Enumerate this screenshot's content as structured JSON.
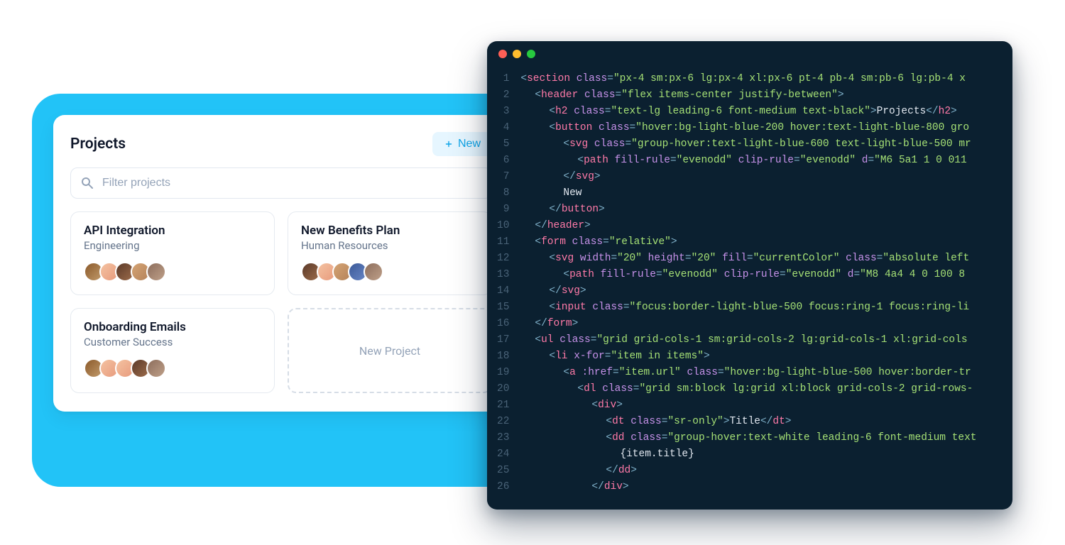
{
  "left": {
    "title": "Projects",
    "new_label": "New",
    "search_placeholder": "Filter projects",
    "projects": [
      {
        "title": "API Integration",
        "subtitle": "Engineering",
        "avatar_count": 5
      },
      {
        "title": "New Benefits Plan",
        "subtitle": "Human Resources",
        "avatar_count": 5
      },
      {
        "title": "Onboarding Emails",
        "subtitle": "Customer Success",
        "avatar_count": 5
      }
    ],
    "new_project_label": "New Project"
  },
  "editor": {
    "traffic_lights": [
      "close",
      "minimize",
      "maximize"
    ],
    "lines": [
      {
        "n": 1,
        "indent": 1,
        "tokens": [
          {
            "c": "t-punc",
            "t": "<"
          },
          {
            "c": "t-tag",
            "t": "section"
          },
          {
            "c": "",
            "t": " "
          },
          {
            "c": "t-attr",
            "t": "class"
          },
          {
            "c": "t-punc",
            "t": "="
          },
          {
            "c": "t-str",
            "t": "\"px-4 sm:px-6 lg:px-4 xl:px-6 pt-4 pb-4 sm:pb-6 lg:pb-4 x"
          }
        ]
      },
      {
        "n": 2,
        "indent": 2,
        "tokens": [
          {
            "c": "t-punc",
            "t": "<"
          },
          {
            "c": "t-tag",
            "t": "header"
          },
          {
            "c": "",
            "t": " "
          },
          {
            "c": "t-attr",
            "t": "class"
          },
          {
            "c": "t-punc",
            "t": "="
          },
          {
            "c": "t-str",
            "t": "\"flex items-center justify-between\""
          },
          {
            "c": "t-punc",
            "t": ">"
          }
        ]
      },
      {
        "n": 3,
        "indent": 3,
        "tokens": [
          {
            "c": "t-punc",
            "t": "<"
          },
          {
            "c": "t-tag",
            "t": "h2"
          },
          {
            "c": "",
            "t": " "
          },
          {
            "c": "t-attr",
            "t": "class"
          },
          {
            "c": "t-punc",
            "t": "="
          },
          {
            "c": "t-str",
            "t": "\"text-lg leading-6 font-medium text-black\""
          },
          {
            "c": "t-punc",
            "t": ">"
          },
          {
            "c": "t-text",
            "t": "Projects"
          },
          {
            "c": "t-punc",
            "t": "</"
          },
          {
            "c": "t-tag",
            "t": "h2"
          },
          {
            "c": "t-punc",
            "t": ">"
          }
        ]
      },
      {
        "n": 4,
        "indent": 3,
        "tokens": [
          {
            "c": "t-punc",
            "t": "<"
          },
          {
            "c": "t-tag",
            "t": "button"
          },
          {
            "c": "",
            "t": " "
          },
          {
            "c": "t-attr",
            "t": "class"
          },
          {
            "c": "t-punc",
            "t": "="
          },
          {
            "c": "t-str",
            "t": "\"hover:bg-light-blue-200 hover:text-light-blue-800 gro"
          }
        ]
      },
      {
        "n": 5,
        "indent": 4,
        "tokens": [
          {
            "c": "t-punc",
            "t": "<"
          },
          {
            "c": "t-tag",
            "t": "svg"
          },
          {
            "c": "",
            "t": " "
          },
          {
            "c": "t-attr",
            "t": "class"
          },
          {
            "c": "t-punc",
            "t": "="
          },
          {
            "c": "t-str",
            "t": "\"group-hover:text-light-blue-600 text-light-blue-500 mr"
          }
        ]
      },
      {
        "n": 6,
        "indent": 5,
        "tokens": [
          {
            "c": "t-punc",
            "t": "<"
          },
          {
            "c": "t-tag",
            "t": "path"
          },
          {
            "c": "",
            "t": " "
          },
          {
            "c": "t-attr",
            "t": "fill-rule"
          },
          {
            "c": "t-punc",
            "t": "="
          },
          {
            "c": "t-str",
            "t": "\"evenodd\""
          },
          {
            "c": "",
            "t": " "
          },
          {
            "c": "t-attr",
            "t": "clip-rule"
          },
          {
            "c": "t-punc",
            "t": "="
          },
          {
            "c": "t-str",
            "t": "\"evenodd\""
          },
          {
            "c": "",
            "t": " "
          },
          {
            "c": "t-attr",
            "t": "d"
          },
          {
            "c": "t-punc",
            "t": "="
          },
          {
            "c": "t-str",
            "t": "\"M6 5a1 1 0 011"
          }
        ]
      },
      {
        "n": 7,
        "indent": 4,
        "tokens": [
          {
            "c": "t-punc",
            "t": "</"
          },
          {
            "c": "t-tag",
            "t": "svg"
          },
          {
            "c": "t-punc",
            "t": ">"
          }
        ]
      },
      {
        "n": 8,
        "indent": 4,
        "tokens": [
          {
            "c": "t-text",
            "t": "New"
          }
        ]
      },
      {
        "n": 9,
        "indent": 3,
        "tokens": [
          {
            "c": "t-punc",
            "t": "</"
          },
          {
            "c": "t-tag",
            "t": "button"
          },
          {
            "c": "t-punc",
            "t": ">"
          }
        ]
      },
      {
        "n": 10,
        "indent": 2,
        "tokens": [
          {
            "c": "t-punc",
            "t": "</"
          },
          {
            "c": "t-tag",
            "t": "header"
          },
          {
            "c": "t-punc",
            "t": ">"
          }
        ]
      },
      {
        "n": 11,
        "indent": 2,
        "tokens": [
          {
            "c": "t-punc",
            "t": "<"
          },
          {
            "c": "t-tag",
            "t": "form"
          },
          {
            "c": "",
            "t": " "
          },
          {
            "c": "t-attr",
            "t": "class"
          },
          {
            "c": "t-punc",
            "t": "="
          },
          {
            "c": "t-str",
            "t": "\"relative\""
          },
          {
            "c": "t-punc",
            "t": ">"
          }
        ]
      },
      {
        "n": 12,
        "indent": 3,
        "tokens": [
          {
            "c": "t-punc",
            "t": "<"
          },
          {
            "c": "t-tag",
            "t": "svg"
          },
          {
            "c": "",
            "t": " "
          },
          {
            "c": "t-attr",
            "t": "width"
          },
          {
            "c": "t-punc",
            "t": "="
          },
          {
            "c": "t-str",
            "t": "\"20\""
          },
          {
            "c": "",
            "t": " "
          },
          {
            "c": "t-attr",
            "t": "height"
          },
          {
            "c": "t-punc",
            "t": "="
          },
          {
            "c": "t-str",
            "t": "\"20\""
          },
          {
            "c": "",
            "t": " "
          },
          {
            "c": "t-attr",
            "t": "fill"
          },
          {
            "c": "t-punc",
            "t": "="
          },
          {
            "c": "t-str",
            "t": "\"currentColor\""
          },
          {
            "c": "",
            "t": " "
          },
          {
            "c": "t-attr",
            "t": "class"
          },
          {
            "c": "t-punc",
            "t": "="
          },
          {
            "c": "t-str",
            "t": "\"absolute left"
          }
        ]
      },
      {
        "n": 13,
        "indent": 4,
        "tokens": [
          {
            "c": "t-punc",
            "t": "<"
          },
          {
            "c": "t-tag",
            "t": "path"
          },
          {
            "c": "",
            "t": " "
          },
          {
            "c": "t-attr",
            "t": "fill-rule"
          },
          {
            "c": "t-punc",
            "t": "="
          },
          {
            "c": "t-str",
            "t": "\"evenodd\""
          },
          {
            "c": "",
            "t": " "
          },
          {
            "c": "t-attr",
            "t": "clip-rule"
          },
          {
            "c": "t-punc",
            "t": "="
          },
          {
            "c": "t-str",
            "t": "\"evenodd\""
          },
          {
            "c": "",
            "t": " "
          },
          {
            "c": "t-attr",
            "t": "d"
          },
          {
            "c": "t-punc",
            "t": "="
          },
          {
            "c": "t-str",
            "t": "\"M8 4a4 4 0 100 8"
          }
        ]
      },
      {
        "n": 14,
        "indent": 3,
        "tokens": [
          {
            "c": "t-punc",
            "t": "</"
          },
          {
            "c": "t-tag",
            "t": "svg"
          },
          {
            "c": "t-punc",
            "t": ">"
          }
        ]
      },
      {
        "n": 15,
        "indent": 3,
        "tokens": [
          {
            "c": "t-punc",
            "t": "<"
          },
          {
            "c": "t-tag",
            "t": "input"
          },
          {
            "c": "",
            "t": " "
          },
          {
            "c": "t-attr",
            "t": "class"
          },
          {
            "c": "t-punc",
            "t": "="
          },
          {
            "c": "t-str",
            "t": "\"focus:border-light-blue-500 focus:ring-1 focus:ring-li"
          }
        ]
      },
      {
        "n": 16,
        "indent": 2,
        "tokens": [
          {
            "c": "t-punc",
            "t": "</"
          },
          {
            "c": "t-tag",
            "t": "form"
          },
          {
            "c": "t-punc",
            "t": ">"
          }
        ]
      },
      {
        "n": 17,
        "indent": 2,
        "tokens": [
          {
            "c": "t-punc",
            "t": "<"
          },
          {
            "c": "t-tag",
            "t": "ul"
          },
          {
            "c": "",
            "t": " "
          },
          {
            "c": "t-attr",
            "t": "class"
          },
          {
            "c": "t-punc",
            "t": "="
          },
          {
            "c": "t-str",
            "t": "\"grid grid-cols-1 sm:grid-cols-2 lg:grid-cols-1 xl:grid-cols"
          }
        ]
      },
      {
        "n": 18,
        "indent": 3,
        "tokens": [
          {
            "c": "t-punc",
            "t": "<"
          },
          {
            "c": "t-tag",
            "t": "li"
          },
          {
            "c": "",
            "t": " "
          },
          {
            "c": "t-attr",
            "t": "x-for"
          },
          {
            "c": "t-punc",
            "t": "="
          },
          {
            "c": "t-str",
            "t": "\"item in items\""
          },
          {
            "c": "t-punc",
            "t": ">"
          }
        ]
      },
      {
        "n": 19,
        "indent": 4,
        "tokens": [
          {
            "c": "t-punc",
            "t": "<"
          },
          {
            "c": "t-tag",
            "t": "a"
          },
          {
            "c": "",
            "t": " "
          },
          {
            "c": "t-attr",
            "t": ":href"
          },
          {
            "c": "t-punc",
            "t": "="
          },
          {
            "c": "t-str",
            "t": "\"item.url\""
          },
          {
            "c": "",
            "t": " "
          },
          {
            "c": "t-attr",
            "t": "class"
          },
          {
            "c": "t-punc",
            "t": "="
          },
          {
            "c": "t-str",
            "t": "\"hover:bg-light-blue-500 hover:border-tr"
          }
        ]
      },
      {
        "n": 20,
        "indent": 5,
        "tokens": [
          {
            "c": "t-punc",
            "t": "<"
          },
          {
            "c": "t-tag",
            "t": "dl"
          },
          {
            "c": "",
            "t": " "
          },
          {
            "c": "t-attr",
            "t": "class"
          },
          {
            "c": "t-punc",
            "t": "="
          },
          {
            "c": "t-str",
            "t": "\"grid sm:block lg:grid xl:block grid-cols-2 grid-rows-"
          }
        ]
      },
      {
        "n": 21,
        "indent": 6,
        "tokens": [
          {
            "c": "t-punc",
            "t": "<"
          },
          {
            "c": "t-tag",
            "t": "div"
          },
          {
            "c": "t-punc",
            "t": ">"
          }
        ]
      },
      {
        "n": 22,
        "indent": 7,
        "tokens": [
          {
            "c": "t-punc",
            "t": "<"
          },
          {
            "c": "t-tag",
            "t": "dt"
          },
          {
            "c": "",
            "t": " "
          },
          {
            "c": "t-attr",
            "t": "class"
          },
          {
            "c": "t-punc",
            "t": "="
          },
          {
            "c": "t-str",
            "t": "\"sr-only\""
          },
          {
            "c": "t-punc",
            "t": ">"
          },
          {
            "c": "t-text",
            "t": "Title"
          },
          {
            "c": "t-punc",
            "t": "</"
          },
          {
            "c": "t-tag",
            "t": "dt"
          },
          {
            "c": "t-punc",
            "t": ">"
          }
        ]
      },
      {
        "n": 23,
        "indent": 7,
        "tokens": [
          {
            "c": "t-punc",
            "t": "<"
          },
          {
            "c": "t-tag",
            "t": "dd"
          },
          {
            "c": "",
            "t": " "
          },
          {
            "c": "t-attr",
            "t": "class"
          },
          {
            "c": "t-punc",
            "t": "="
          },
          {
            "c": "t-str",
            "t": "\"group-hover:text-white leading-6 font-medium text"
          }
        ]
      },
      {
        "n": 24,
        "indent": 8,
        "tokens": [
          {
            "c": "t-expr",
            "t": "{item.title}"
          }
        ]
      },
      {
        "n": 25,
        "indent": 7,
        "tokens": [
          {
            "c": "t-punc",
            "t": "</"
          },
          {
            "c": "t-tag",
            "t": "dd"
          },
          {
            "c": "t-punc",
            "t": ">"
          }
        ]
      },
      {
        "n": 26,
        "indent": 6,
        "tokens": [
          {
            "c": "t-punc",
            "t": "</"
          },
          {
            "c": "t-tag",
            "t": "div"
          },
          {
            "c": "t-punc",
            "t": ">"
          }
        ]
      }
    ]
  }
}
